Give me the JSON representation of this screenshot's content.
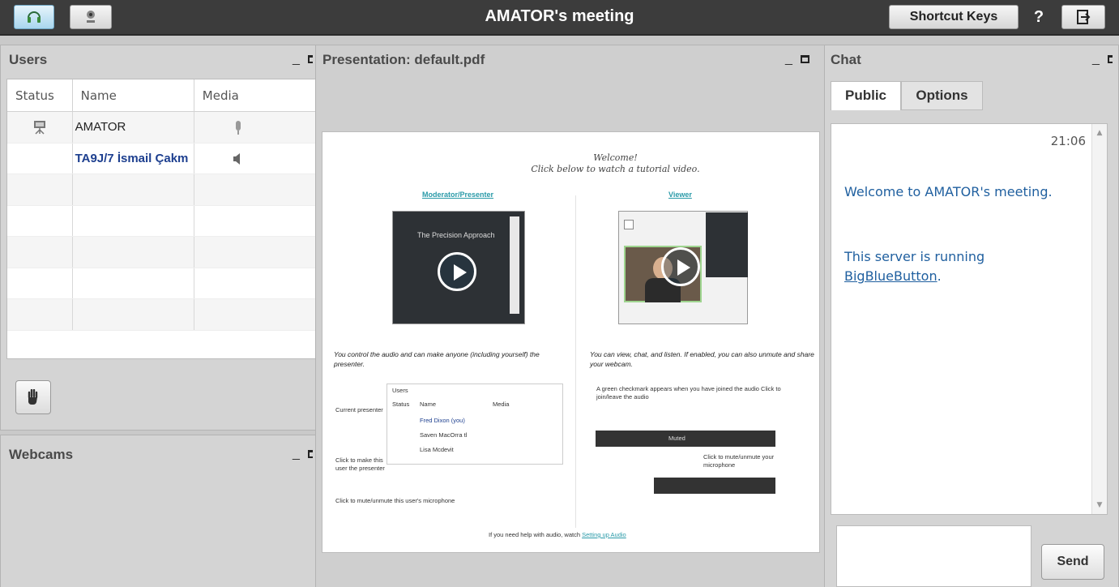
{
  "header": {
    "title": "AMATOR's meeting",
    "shortcut_label": "Shortcut Keys",
    "help_label": "?",
    "icons": [
      "headset-icon",
      "webcam-icon",
      "logout-icon"
    ]
  },
  "users_panel": {
    "title": "Users",
    "columns": [
      "Status",
      "Name",
      "Media"
    ],
    "rows": [
      {
        "name": "AMATOR",
        "status_icon": "presenter-icon",
        "media_icon": "microphone-icon"
      },
      {
        "name": "TA9J/7 İsmail Çakm",
        "status_icon": "",
        "media_icon": "speaker-icon"
      }
    ]
  },
  "webcams_panel": {
    "title": "Webcams"
  },
  "presentation_panel": {
    "title": "Presentation: default.pdf",
    "slide": {
      "welcome_line1": "Welcome!",
      "welcome_line2": "Click below to watch a tutorial video.",
      "moderator_heading": "Moderator/Presenter",
      "viewer_heading": "Viewer",
      "thumb_caption": "The Precision Approach",
      "moderator_text": "You control the audio and can make anyone (including yourself) the presenter.",
      "viewer_text": "You can view, chat, and listen.  If enabled, you can also unmute and share your webcam.",
      "current_presenter": "Current presenter",
      "click_make_presenter": "Click to make this user the presenter",
      "click_mute_user": "Click to mute/unmute this user's microphone",
      "green_check": "A green checkmark appears when you have joined the audio   Click to join/leave the audio",
      "click_mute_mic": "Click to mute/unmute your microphone",
      "mini_users_title": "Users",
      "mini_cols": [
        "Status",
        "Name",
        "Media"
      ],
      "mini_rows": [
        "Fred Dixon (you)",
        "Saven MacOrra tl",
        "Lisa Mcdevit"
      ],
      "mini_muted": "Muted",
      "help_text": "If you need help with audio, watch",
      "help_link": "Setting up Audio"
    }
  },
  "chat_panel": {
    "title": "Chat",
    "tabs": [
      "Public",
      "Options"
    ],
    "time": "21:06",
    "message1": "Welcome to AMATOR's meeting.",
    "message2_prefix": "This server is running",
    "message2_link": "BigBlueButton",
    "message2_suffix": ".",
    "send_label": "Send"
  }
}
